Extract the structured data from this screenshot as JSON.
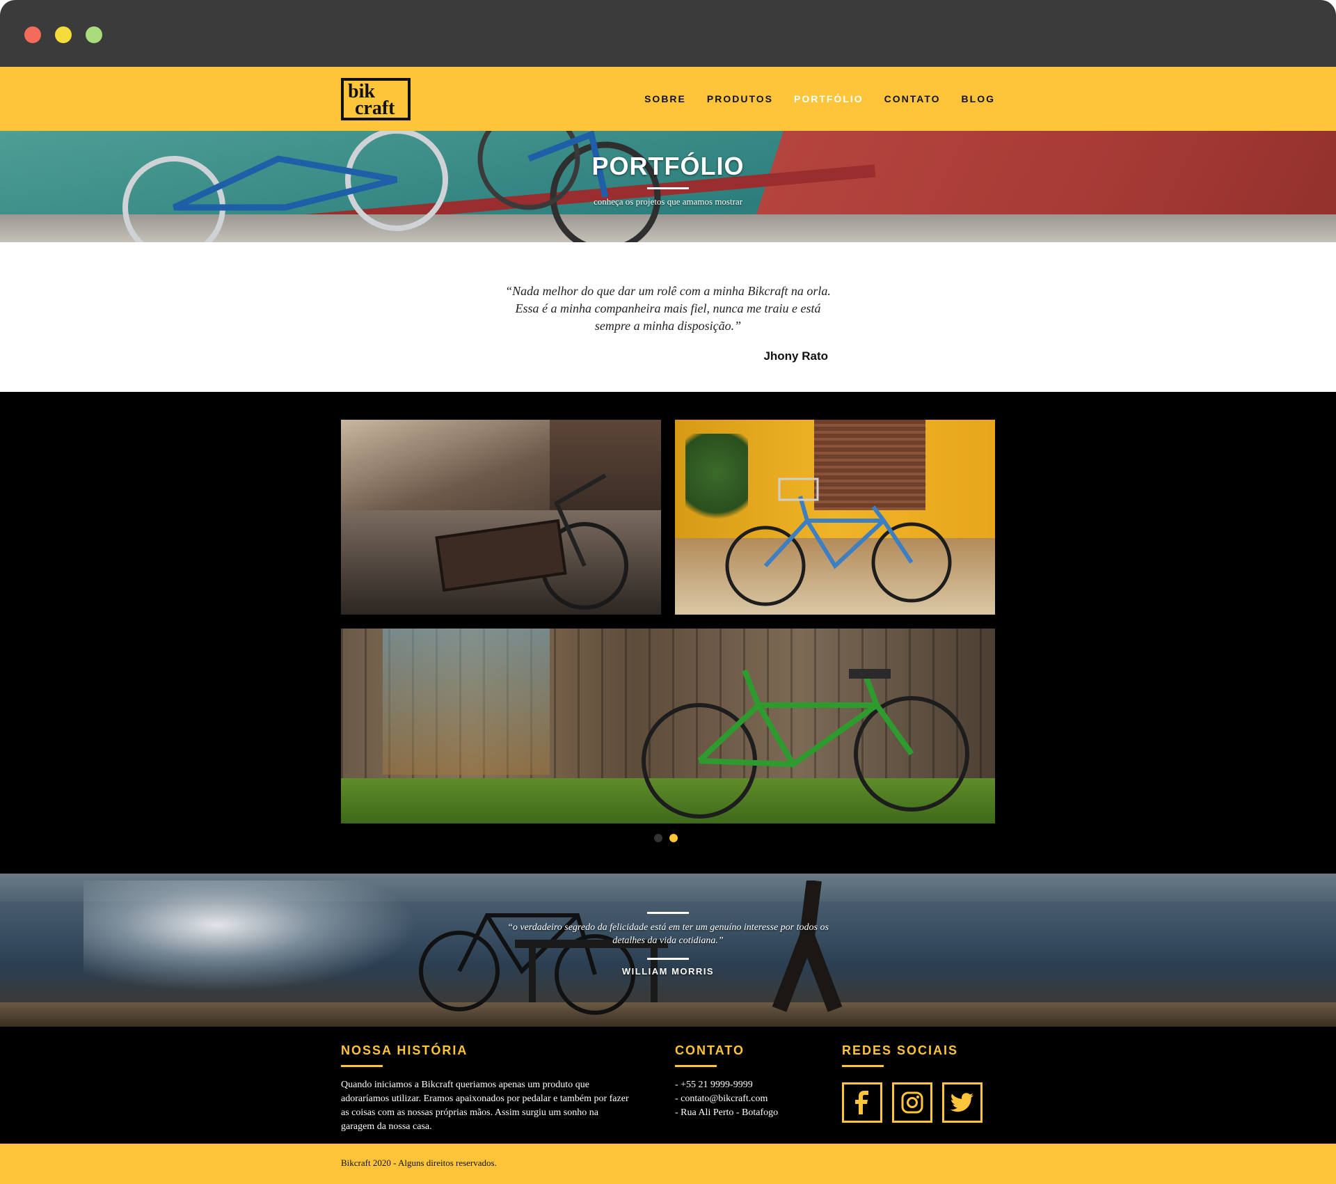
{
  "brand": {
    "logo_line1": "bik",
    "logo_line2": "craft",
    "accent_color": "#fec53b"
  },
  "nav": {
    "items": [
      {
        "label": "SOBRE"
      },
      {
        "label": "PRODUTOS"
      },
      {
        "label": "PORTFÓLIO",
        "active": true
      },
      {
        "label": "CONTATO"
      },
      {
        "label": "BLOG"
      }
    ]
  },
  "hero": {
    "title": "PORTFÓLIO",
    "subtitle": "conheça os projetos que amamos mostrar"
  },
  "quote": {
    "text": "“Nada melhor do que dar um rolê com a minha Bikcraft na orla. Essa é a minha companheira mais fiel, nunca me traiu e está sempre a minha disposição.”",
    "author": "Jhony Rato"
  },
  "gallery": {
    "images": [
      "street-bike-photo",
      "yellow-wall-bike-photo",
      "green-bike-fence-photo"
    ],
    "pager": {
      "count": 2,
      "active_index": 1
    }
  },
  "testimonial": {
    "text": "“o verdadeiro segredo da felicidade está em ter um genuíno interesse por todos os detalhes da vida cotidiana.”",
    "author": "WILLIAM MORRIS"
  },
  "footer": {
    "history": {
      "title": "NOSSA HISTÓRIA",
      "text": "Quando iniciamos a Bikcraft queriamos apenas um produto que adoraríamos utilizar. Eramos apaixonados por pedalar e também por fazer as coisas com as nossas próprias mãos. Assim surgiu um sonho na garagem da nossa casa."
    },
    "contact": {
      "title": "CONTATO",
      "items": [
        "- +55 21 9999-9999",
        "- contato@bikcraft.com",
        "- Rua Ali Perto - Botafogo"
      ]
    },
    "social": {
      "title": "REDES SOCIAIS",
      "icons": [
        "facebook-icon",
        "instagram-icon",
        "twitter-icon"
      ]
    }
  },
  "copyright": "Bikcraft 2020 - Alguns direitos reservados."
}
